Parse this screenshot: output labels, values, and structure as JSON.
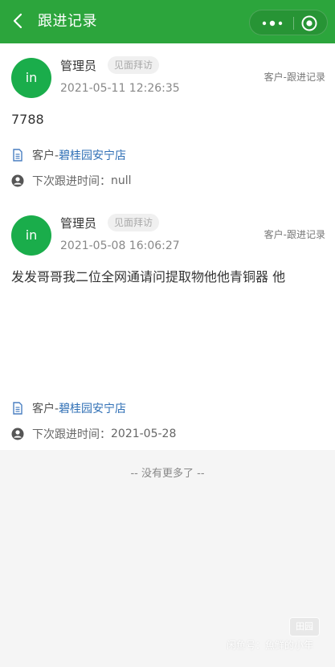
{
  "header": {
    "title": "跟进记录",
    "bg_color": "#2ca53c"
  },
  "records": [
    {
      "avatar_text": "in",
      "name": "管理员",
      "visit_tag": "见面拜访",
      "time": "2021-05-11 12:26:35",
      "category": "客户-跟进记录",
      "content": "7788",
      "customer_prefix": "客户-",
      "customer_name": "碧桂园安宁店",
      "next_label": "下次跟进时间：",
      "next_value": "null"
    },
    {
      "avatar_text": "in",
      "name": "管理员",
      "visit_tag": "见面拜访",
      "time": "2021-05-08 16:06:27",
      "category": "客户-跟进记录",
      "content": "发发哥哥我二位全网通请问提取物他他青铜器 他",
      "customer_prefix": "客户-",
      "customer_name": "碧桂园安宁店",
      "next_label": "下次跟进时间：",
      "next_value": "2021-05-28"
    }
  ],
  "footer": {
    "no_more": "-- 没有更多了 --"
  },
  "watermark": {
    "box": "田园",
    "text": "闲鱼号：魚鲜的小年"
  },
  "icons": {
    "back": "chevron-left-icon",
    "more": "more-dots-icon",
    "close": "capsule-close-icon",
    "customer": "document-icon",
    "next": "person-icon"
  },
  "colors": {
    "accent": "#2ca53c",
    "avatar": "#1aad4b",
    "link": "#2f6fb5"
  }
}
